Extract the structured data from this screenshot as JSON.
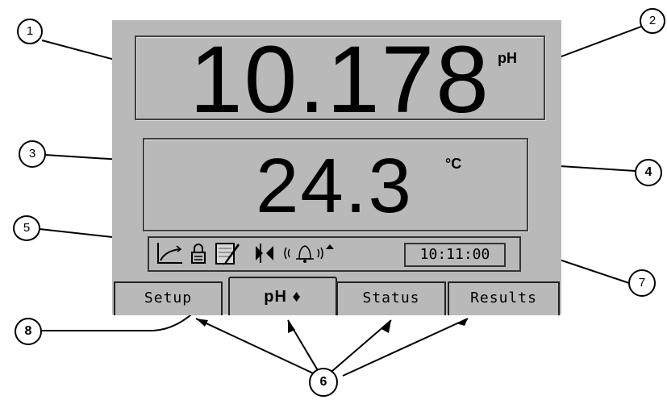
{
  "readings": {
    "ph_value": "10.178",
    "ph_unit": "pH",
    "temp_value": "24.3",
    "temp_unit": "°C"
  },
  "status_bar": {
    "time": "10:11:00",
    "icons": [
      "calibration-curve-icon",
      "lock-icon",
      "notepad-pen-icon",
      "stirrer-icon",
      "alarm-bell-icon",
      "up-triangle-icon"
    ]
  },
  "tabs": [
    {
      "label": "Setup"
    },
    {
      "label": "pH ♦"
    },
    {
      "label": "Status"
    },
    {
      "label": "Results"
    }
  ],
  "callouts": [
    "1",
    "2",
    "3",
    "4",
    "5",
    "6",
    "7",
    "8"
  ]
}
